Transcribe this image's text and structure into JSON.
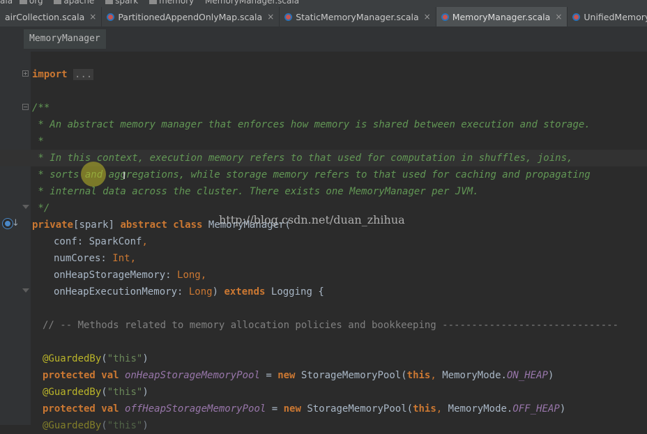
{
  "breadcrumbs": [
    "ala",
    "org",
    "apache",
    "spark",
    "memory",
    "MemoryManager.scala"
  ],
  "tabs": [
    {
      "label": "airCollection.scala",
      "active": false
    },
    {
      "label": "PartitionedAppendOnlyMap.scala",
      "active": false
    },
    {
      "label": "StaticMemoryManager.scala",
      "active": false
    },
    {
      "label": "MemoryManager.scala",
      "active": true
    },
    {
      "label": "UnifiedMemoryManager",
      "active": false
    }
  ],
  "close_glyph": "×",
  "structure_crumb": "MemoryManager",
  "code": {
    "import_kw": "import",
    "import_fold": "...",
    "doc_open": "/**",
    "doc_1": " * An abstract memory manager that enforces how memory is shared between execution and storage.",
    "doc_2": " *",
    "doc_3": " * In this context, execution memory refers to that used for computation in shuffles, joins,",
    "doc_4": " * sorts and aggregations, while storage memory refers to that used for caching and propagating",
    "doc_5": " * internal data across the cluster. There exists one MemoryManager per JVM.",
    "doc_close": " */",
    "class_kw1": "private",
    "class_pkg": "[spark] ",
    "class_kw2": "abstract class",
    "class_name": " MemoryManager(",
    "p1_name": "conf: SparkConf",
    "p2_name": "numCores: ",
    "p2_type": "Int",
    "p3_name": "onHeapStorageMemory: ",
    "p3_type": "Long",
    "p4_name": "onHeapExecutionMemory: ",
    "p4_type": "Long",
    "p4_end": ") ",
    "extends_kw": "extends",
    "extends_rest": " Logging {",
    "section_comment": "// -- Methods related to memory allocation policies and bookkeeping ------------------------------",
    "ann": "@GuardedBy",
    "ann_arg": "\"this\"",
    "decl_kw": "protected val",
    "f1_name": "onHeapStorageMemoryPool",
    "f2_name": "offHeapStorageMemoryPool",
    "eq": " = ",
    "new_kw": "new",
    "pool_class": " StorageMemoryPool(",
    "this_kw": "this",
    "mode_prefix": " MemoryMode.",
    "mode1": "ON_HEAP",
    "mode2": "OFF_HEAP",
    "comma": ",",
    "close_paren": ")"
  },
  "watermark": "http://blog.csdn.net/duan_zhihua"
}
